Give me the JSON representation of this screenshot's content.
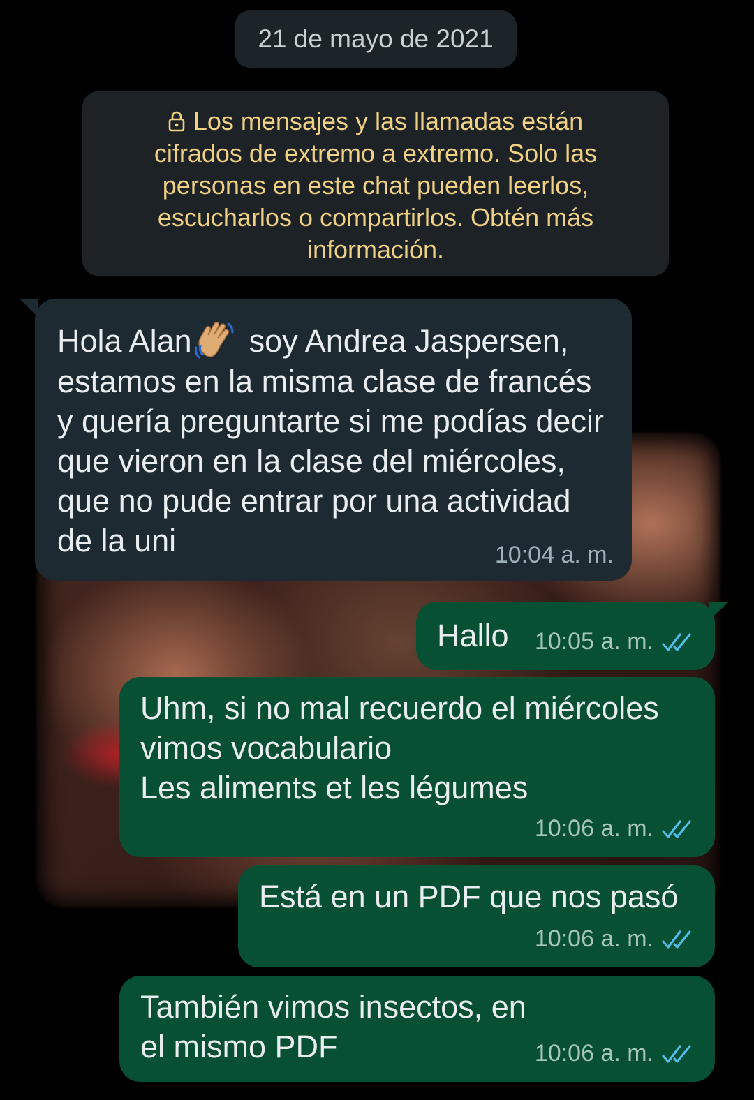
{
  "date_chip": "21 de mayo de 2021",
  "encryption_notice": {
    "icon": "lock-icon",
    "text": "Los mensajes y las llamadas están cifrados de extremo a extremo. Solo las personas en este chat pueden leerlos, escucharlos o compartirlos. Obtén más información.",
    "color": "#f0d083"
  },
  "messages": [
    {
      "direction": "incoming",
      "text_before_emoji": "Hola Alan",
      "emoji": "waving-hand-emoji",
      "text_after_emoji": "soy Andrea Jaspersen,\nestamos en la misma clase de francés y quería preguntarte si me podías decir que vieron en la clase del miércoles, que no pude entrar por una actividad de la uni",
      "time": "10:04 a. m."
    },
    {
      "direction": "outgoing",
      "text": "Hallo",
      "time": "10:05 a. m.",
      "status": "read"
    },
    {
      "direction": "outgoing",
      "text": "Uhm, si no mal recuerdo el miércoles vimos vocabulario\nLes aliments et les légumes",
      "time": "10:06 a. m.",
      "status": "read"
    },
    {
      "direction": "outgoing",
      "text": "Está en un PDF que nos pasó",
      "time": "10:06 a. m.",
      "status": "read"
    },
    {
      "direction": "outgoing",
      "text": "También vimos insectos, en el mismo PDF",
      "time": "10:06 a. m.",
      "status": "read"
    }
  ],
  "colors": {
    "background": "#000000",
    "incoming_bubble": "#1e2a31",
    "outgoing_bubble": "#075033",
    "read_ticks": "#53bdeb"
  }
}
